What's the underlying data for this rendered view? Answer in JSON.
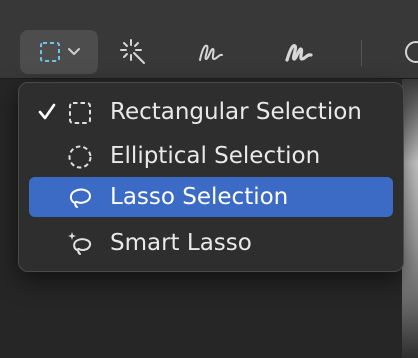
{
  "toolbar": {
    "tools": [
      {
        "icon": "rectangular-selection-icon",
        "has_dropdown": true,
        "active": true
      },
      {
        "icon": "magic-wand-icon"
      },
      {
        "icon": "sketch-icon"
      },
      {
        "icon": "draw-icon"
      }
    ]
  },
  "menu": {
    "items": [
      {
        "label": "Rectangular Selection",
        "icon": "rectangular-selection-icon",
        "checked": true,
        "highlighted": false
      },
      {
        "label": "Elliptical Selection",
        "icon": "elliptical-selection-icon",
        "checked": false,
        "highlighted": false
      },
      {
        "label": "Lasso Selection",
        "icon": "lasso-icon",
        "checked": false,
        "highlighted": true
      },
      {
        "label": "Smart Lasso",
        "icon": "smart-lasso-icon",
        "checked": false,
        "highlighted": false
      }
    ]
  },
  "colors": {
    "toolbar_bg": "#383838",
    "menu_bg": "#2f2e2e",
    "highlight": "#3b6bc4",
    "text": "#e9e9e9",
    "accent_icon": "#6fc3e8"
  }
}
